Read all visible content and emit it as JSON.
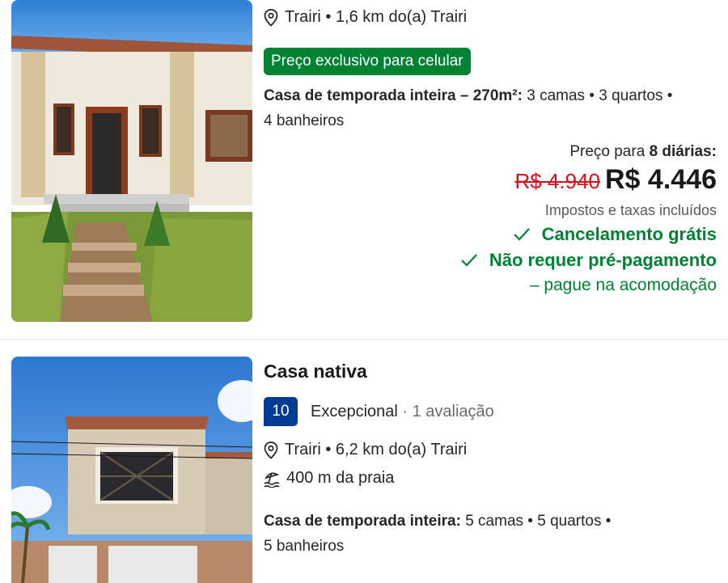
{
  "listing1": {
    "location": "Trairi • 1,6 km do(a) Trairi",
    "promo_badge": "Preço exclusivo para celular",
    "unit_type": "Casa de temporada inteira – 270m²:",
    "unit_details": "3 camas • 3 quartos •",
    "unit_details_2": "4 banheiros",
    "price_for_prefix": "Preço para",
    "price_for_nights": "8 diárias:",
    "price_old": "R$ 4.940",
    "price_new": "R$ 4.446",
    "taxes_note": "Impostos e taxas incluídos",
    "perk_cancel": "Cancelamento grátis",
    "perk_prepay": "Não requer pré-pagamento",
    "perk_prepay_sub": "– pague na acomodação"
  },
  "listing2": {
    "title": "Casa nativa",
    "score": "10",
    "rating_word": "Excepcional",
    "rating_count": "· 1 avaliação",
    "location": "Trairi • 6,2 km do(a) Trairi",
    "beach_distance": "400 m da praia",
    "unit_type": "Casa de temporada inteira:",
    "unit_details": "5 camas • 5 quartos •",
    "unit_details_2": "5 banheiros"
  },
  "colors": {
    "green": "#008234",
    "score_blue": "#003b95",
    "discount_red": "#d4111e"
  },
  "icons": [
    "map-pin-icon",
    "beach-icon",
    "check-icon"
  ]
}
